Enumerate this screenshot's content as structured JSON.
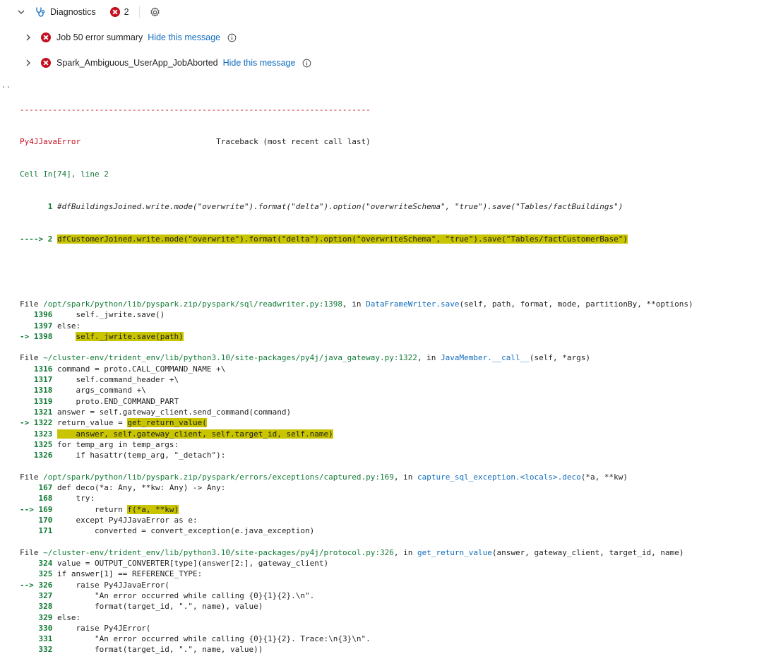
{
  "diagnostics": {
    "title": "Diagnostics",
    "count": "2",
    "messages": [
      {
        "label": "Job 50 error summary",
        "action": "Hide this message"
      },
      {
        "label": "Spark_Ambiguous_UserApp_JobAborted",
        "action": "Hide this message"
      }
    ]
  },
  "traceback": {
    "gutter": "..",
    "dashes": "---------------------------------------------------------------------------",
    "error_type": "Py4JJavaError",
    "header_label": "Traceback (most recent call last)",
    "cell": "Cell In[74], line 2",
    "cell_lines": [
      {
        "no": "      1",
        "text": " #dfBuildingsJoined.write.mode(\"overwrite\").format(\"delta\").option(\"overwriteSchema\", \"true\").save(\"Tables/factBuildings\")"
      },
      {
        "no": "----> 2",
        "text": "dfCustomerJoined.write.mode(\"overwrite\").format(\"delta\").option(\"overwriteSchema\", \"true\").save(\"Tables/factCustomerBase\")"
      }
    ],
    "frames": [
      {
        "file_prefix": "File ",
        "path": "/opt/spark/python/lib/pyspark.zip/pyspark/sql/readwriter.py:1398",
        "in": ", in ",
        "func": "DataFrameWriter.save",
        "args": "(self, path, format, mode, partitionBy, **options)",
        "lines": [
          {
            "no": "   1396",
            "pre": "     self._jwrite.save()",
            "hl": "",
            "post": ""
          },
          {
            "no": "   1397",
            "pre": " else:",
            "hl": "",
            "post": ""
          },
          {
            "no": "-> 1398",
            "pre": "     ",
            "hl": "self._jwrite.save(path)",
            "post": ""
          }
        ]
      },
      {
        "file_prefix": "File ",
        "path": "~/cluster-env/trident_env/lib/python3.10/site-packages/py4j/java_gateway.py:1322",
        "in": ", in ",
        "func": "JavaMember.__call__",
        "args": "(self, *args)",
        "lines": [
          {
            "no": "   1316",
            "pre": " command = proto.CALL_COMMAND_NAME +\\",
            "hl": "",
            "post": ""
          },
          {
            "no": "   1317",
            "pre": "     self.command_header +\\",
            "hl": "",
            "post": ""
          },
          {
            "no": "   1318",
            "pre": "     args_command +\\",
            "hl": "",
            "post": ""
          },
          {
            "no": "   1319",
            "pre": "     proto.END_COMMAND_PART",
            "hl": "",
            "post": ""
          },
          {
            "no": "   1321",
            "pre": " answer = self.gateway_client.send_command(command)",
            "hl": "",
            "post": ""
          },
          {
            "no": "-> 1322",
            "pre": " return_value = ",
            "hl": "get_return_value(",
            "post": ""
          },
          {
            "no": "   1323",
            "pre": " ",
            "hl": "    answer, self.gateway_client, self.target_id, self.name)",
            "post": ""
          },
          {
            "no": "   1325",
            "pre": " for temp_arg in temp_args:",
            "hl": "",
            "post": ""
          },
          {
            "no": "   1326",
            "pre": "     if hasattr(temp_arg, \"_detach\"):",
            "hl": "",
            "post": ""
          }
        ]
      },
      {
        "file_prefix": "File ",
        "path": "/opt/spark/python/lib/pyspark.zip/pyspark/errors/exceptions/captured.py:169",
        "in": ", in ",
        "func": "capture_sql_exception.<locals>.deco",
        "args": "(*a, **kw)",
        "lines": [
          {
            "no": "    167",
            "pre": " def deco(*a: Any, **kw: Any) -> Any:",
            "hl": "",
            "post": ""
          },
          {
            "no": "    168",
            "pre": "     try:",
            "hl": "",
            "post": ""
          },
          {
            "no": "--> 169",
            "pre": "         return ",
            "hl": "f(*a, **kw)",
            "post": ""
          },
          {
            "no": "    170",
            "pre": "     except Py4JJavaError as e:",
            "hl": "",
            "post": ""
          },
          {
            "no": "    171",
            "pre": "         converted = convert_exception(e.java_exception)",
            "hl": "",
            "post": ""
          }
        ]
      },
      {
        "file_prefix": "File ",
        "path": "~/cluster-env/trident_env/lib/python3.10/site-packages/py4j/protocol.py:326",
        "in": ", in ",
        "func": "get_return_value",
        "args": "(answer, gateway_client, target_id, name)",
        "lines": [
          {
            "no": "    324",
            "pre": " value = OUTPUT_CONVERTER[type](answer[2:], gateway_client)",
            "hl": "",
            "post": ""
          },
          {
            "no": "    325",
            "pre": " if answer[1] == REFERENCE_TYPE:",
            "hl": "",
            "post": ""
          },
          {
            "no": "--> 326",
            "pre": "     raise Py4JJavaError(",
            "hl": "",
            "post": ""
          },
          {
            "no": "    327",
            "pre": "         \"An error occurred while calling {0}{1}{2}.\\n\".",
            "hl": "",
            "post": ""
          },
          {
            "no": "    328",
            "pre": "         format(target_id, \".\", name), value)",
            "hl": "",
            "post": ""
          },
          {
            "no": "    329",
            "pre": " else:",
            "hl": "",
            "post": ""
          },
          {
            "no": "    330",
            "pre": "     raise Py4JError(",
            "hl": "",
            "post": ""
          },
          {
            "no": "    331",
            "pre": "         \"An error occurred while calling {0}{1}{2}. Trace:\\n{3}\\n\".",
            "hl": "",
            "post": ""
          },
          {
            "no": "    332",
            "pre": "         format(target_id, \".\", name, value))",
            "hl": "",
            "post": ""
          }
        ]
      }
    ]
  }
}
